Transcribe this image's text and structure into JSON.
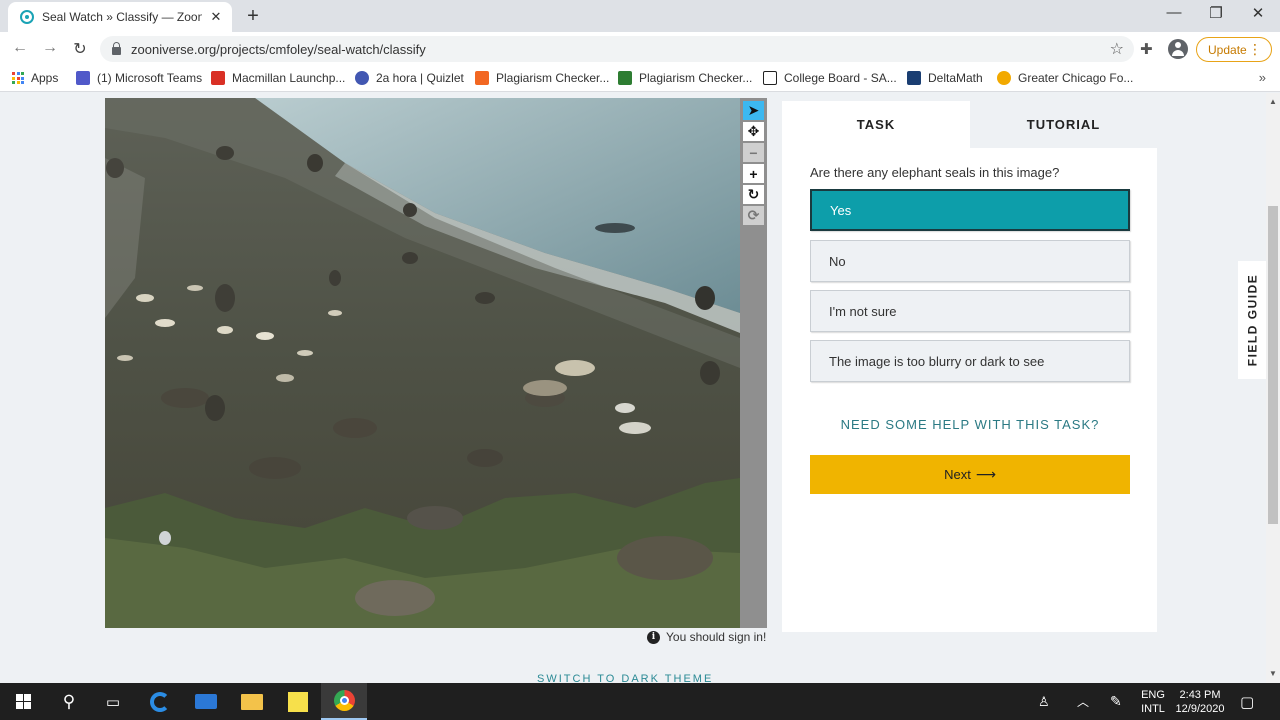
{
  "browser": {
    "tab_title": "Seal Watch » Classify — Zooniverse",
    "new_tab": "+",
    "url": "zooniverse.org/projects/cmfoley/seal-watch/classify",
    "update_label": "Update",
    "window_controls": {
      "minimize": "—",
      "maximize": "❐",
      "close": "✕"
    }
  },
  "bookmarks": [
    {
      "label": "Apps",
      "icon": "apps-grid-icon"
    },
    {
      "label": "(1) Microsoft Teams",
      "icon": "teams-icon",
      "color": "#5059c9"
    },
    {
      "label": "Macmillan Launchp...",
      "icon": "macmillan-icon",
      "color": "#d93025"
    },
    {
      "label": "2a hora | Quizlet",
      "icon": "quizlet-icon",
      "color": "#4257b2"
    },
    {
      "label": "Plagiarism Checker...",
      "icon": "plagiarism-icon",
      "color": "#f26722"
    },
    {
      "label": "Plagiarism Checker...",
      "icon": "plagiarism-icon-2",
      "color": "#2e7d32"
    },
    {
      "label": "College Board - SA...",
      "icon": "college-board-icon",
      "color": "#222222"
    },
    {
      "label": "DeltaMath",
      "icon": "deltamath-icon",
      "color": "#1a3e72"
    },
    {
      "label": "Greater Chicago Fo...",
      "icon": "greater-chicago-icon",
      "color": "#f2a900"
    }
  ],
  "image_toolbar": [
    "pointer-icon",
    "move-icon",
    "zoom-out-icon",
    "zoom-in-icon",
    "rotate-icon",
    "reset-icon"
  ],
  "sign_in_notice": "You should sign in!",
  "dark_theme_link": "SWITCH TO DARK THEME",
  "task": {
    "tabs": [
      "TASK",
      "TUTORIAL"
    ],
    "question": "Are there any elephant seals in this image?",
    "answers": [
      "Yes",
      "No",
      "I'm not sure",
      "The image is too blurry or dark to see"
    ],
    "selected_answer": "Yes",
    "help_link": "NEED SOME HELP WITH THIS TASK?",
    "next_label": "Next",
    "next_arrow": "⟶"
  },
  "field_guide": "FIELD GUIDE",
  "colors": {
    "accent_teal": "#0d9eaa",
    "next_yellow": "#f0b400",
    "link_teal": "#2b7a84",
    "update_orange": "#e8a317"
  },
  "taskbar": {
    "language": "ENG",
    "keyboard": "INTL",
    "time": "2:43 PM",
    "date": "12/9/2020"
  }
}
